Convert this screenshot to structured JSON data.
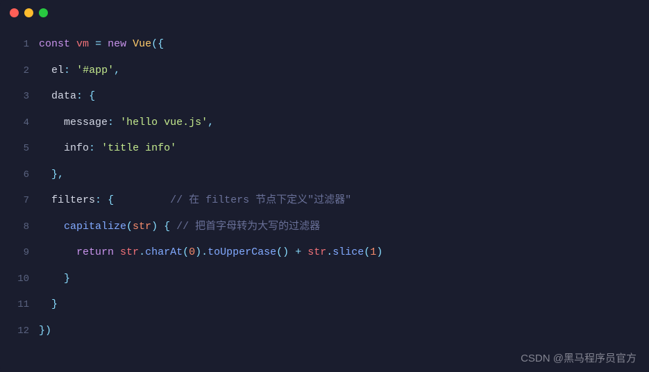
{
  "traffic_lights": {
    "red": "#ff5f57",
    "yellow": "#febc2e",
    "green": "#28c840"
  },
  "code": {
    "lines": [
      {
        "num": "1",
        "tokens": [
          {
            "cls": "kw",
            "t": "const"
          },
          {
            "cls": "plain",
            "t": " "
          },
          {
            "cls": "var",
            "t": "vm"
          },
          {
            "cls": "plain",
            "t": " "
          },
          {
            "cls": "op",
            "t": "="
          },
          {
            "cls": "plain",
            "t": " "
          },
          {
            "cls": "kw",
            "t": "new"
          },
          {
            "cls": "plain",
            "t": " "
          },
          {
            "cls": "cls",
            "t": "Vue"
          },
          {
            "cls": "punc",
            "t": "({"
          }
        ]
      },
      {
        "num": "2",
        "tokens": [
          {
            "cls": "plain",
            "t": "  "
          },
          {
            "cls": "prop",
            "t": "el"
          },
          {
            "cls": "punc",
            "t": ":"
          },
          {
            "cls": "plain",
            "t": " "
          },
          {
            "cls": "str",
            "t": "'#app'"
          },
          {
            "cls": "punc",
            "t": ","
          }
        ]
      },
      {
        "num": "3",
        "tokens": [
          {
            "cls": "plain",
            "t": "  "
          },
          {
            "cls": "prop",
            "t": "data"
          },
          {
            "cls": "punc",
            "t": ":"
          },
          {
            "cls": "plain",
            "t": " "
          },
          {
            "cls": "punc",
            "t": "{"
          }
        ]
      },
      {
        "num": "4",
        "tokens": [
          {
            "cls": "plain",
            "t": "    "
          },
          {
            "cls": "prop",
            "t": "message"
          },
          {
            "cls": "punc",
            "t": ":"
          },
          {
            "cls": "plain",
            "t": " "
          },
          {
            "cls": "str",
            "t": "'hello vue.js'"
          },
          {
            "cls": "punc",
            "t": ","
          }
        ]
      },
      {
        "num": "5",
        "tokens": [
          {
            "cls": "plain",
            "t": "    "
          },
          {
            "cls": "prop",
            "t": "info"
          },
          {
            "cls": "punc",
            "t": ":"
          },
          {
            "cls": "plain",
            "t": " "
          },
          {
            "cls": "str",
            "t": "'title info'"
          }
        ]
      },
      {
        "num": "6",
        "tokens": [
          {
            "cls": "plain",
            "t": "  "
          },
          {
            "cls": "punc",
            "t": "},"
          }
        ]
      },
      {
        "num": "7",
        "tokens": [
          {
            "cls": "plain",
            "t": "  "
          },
          {
            "cls": "prop",
            "t": "filters"
          },
          {
            "cls": "punc",
            "t": ":"
          },
          {
            "cls": "plain",
            "t": " "
          },
          {
            "cls": "punc",
            "t": "{"
          },
          {
            "cls": "plain",
            "t": "         "
          },
          {
            "cls": "comment",
            "t": "// 在 filters 节点下定义\"过滤器\""
          }
        ]
      },
      {
        "num": "8",
        "tokens": [
          {
            "cls": "plain",
            "t": "    "
          },
          {
            "cls": "fn",
            "t": "capitalize"
          },
          {
            "cls": "punc",
            "t": "("
          },
          {
            "cls": "param",
            "t": "str"
          },
          {
            "cls": "punc",
            "t": ")"
          },
          {
            "cls": "plain",
            "t": " "
          },
          {
            "cls": "punc",
            "t": "{"
          },
          {
            "cls": "plain",
            "t": " "
          },
          {
            "cls": "comment",
            "t": "// 把首字母转为大写的过滤器"
          }
        ]
      },
      {
        "num": "9",
        "tokens": [
          {
            "cls": "plain",
            "t": "      "
          },
          {
            "cls": "kw",
            "t": "return"
          },
          {
            "cls": "plain",
            "t": " "
          },
          {
            "cls": "var",
            "t": "str"
          },
          {
            "cls": "punc",
            "t": "."
          },
          {
            "cls": "fn",
            "t": "charAt"
          },
          {
            "cls": "punc",
            "t": "("
          },
          {
            "cls": "num",
            "t": "0"
          },
          {
            "cls": "punc",
            "t": ")."
          },
          {
            "cls": "fn",
            "t": "toUpperCase"
          },
          {
            "cls": "punc",
            "t": "()"
          },
          {
            "cls": "plain",
            "t": " "
          },
          {
            "cls": "op",
            "t": "+"
          },
          {
            "cls": "plain",
            "t": " "
          },
          {
            "cls": "var",
            "t": "str"
          },
          {
            "cls": "punc",
            "t": "."
          },
          {
            "cls": "fn",
            "t": "slice"
          },
          {
            "cls": "punc",
            "t": "("
          },
          {
            "cls": "num",
            "t": "1"
          },
          {
            "cls": "punc",
            "t": ")"
          }
        ]
      },
      {
        "num": "10",
        "tokens": [
          {
            "cls": "plain",
            "t": "    "
          },
          {
            "cls": "punc",
            "t": "}"
          }
        ]
      },
      {
        "num": "11",
        "tokens": [
          {
            "cls": "plain",
            "t": "  "
          },
          {
            "cls": "punc",
            "t": "}"
          }
        ]
      },
      {
        "num": "12",
        "tokens": [
          {
            "cls": "punc",
            "t": "})"
          }
        ]
      }
    ]
  },
  "watermark": "CSDN @黑马程序员官方"
}
